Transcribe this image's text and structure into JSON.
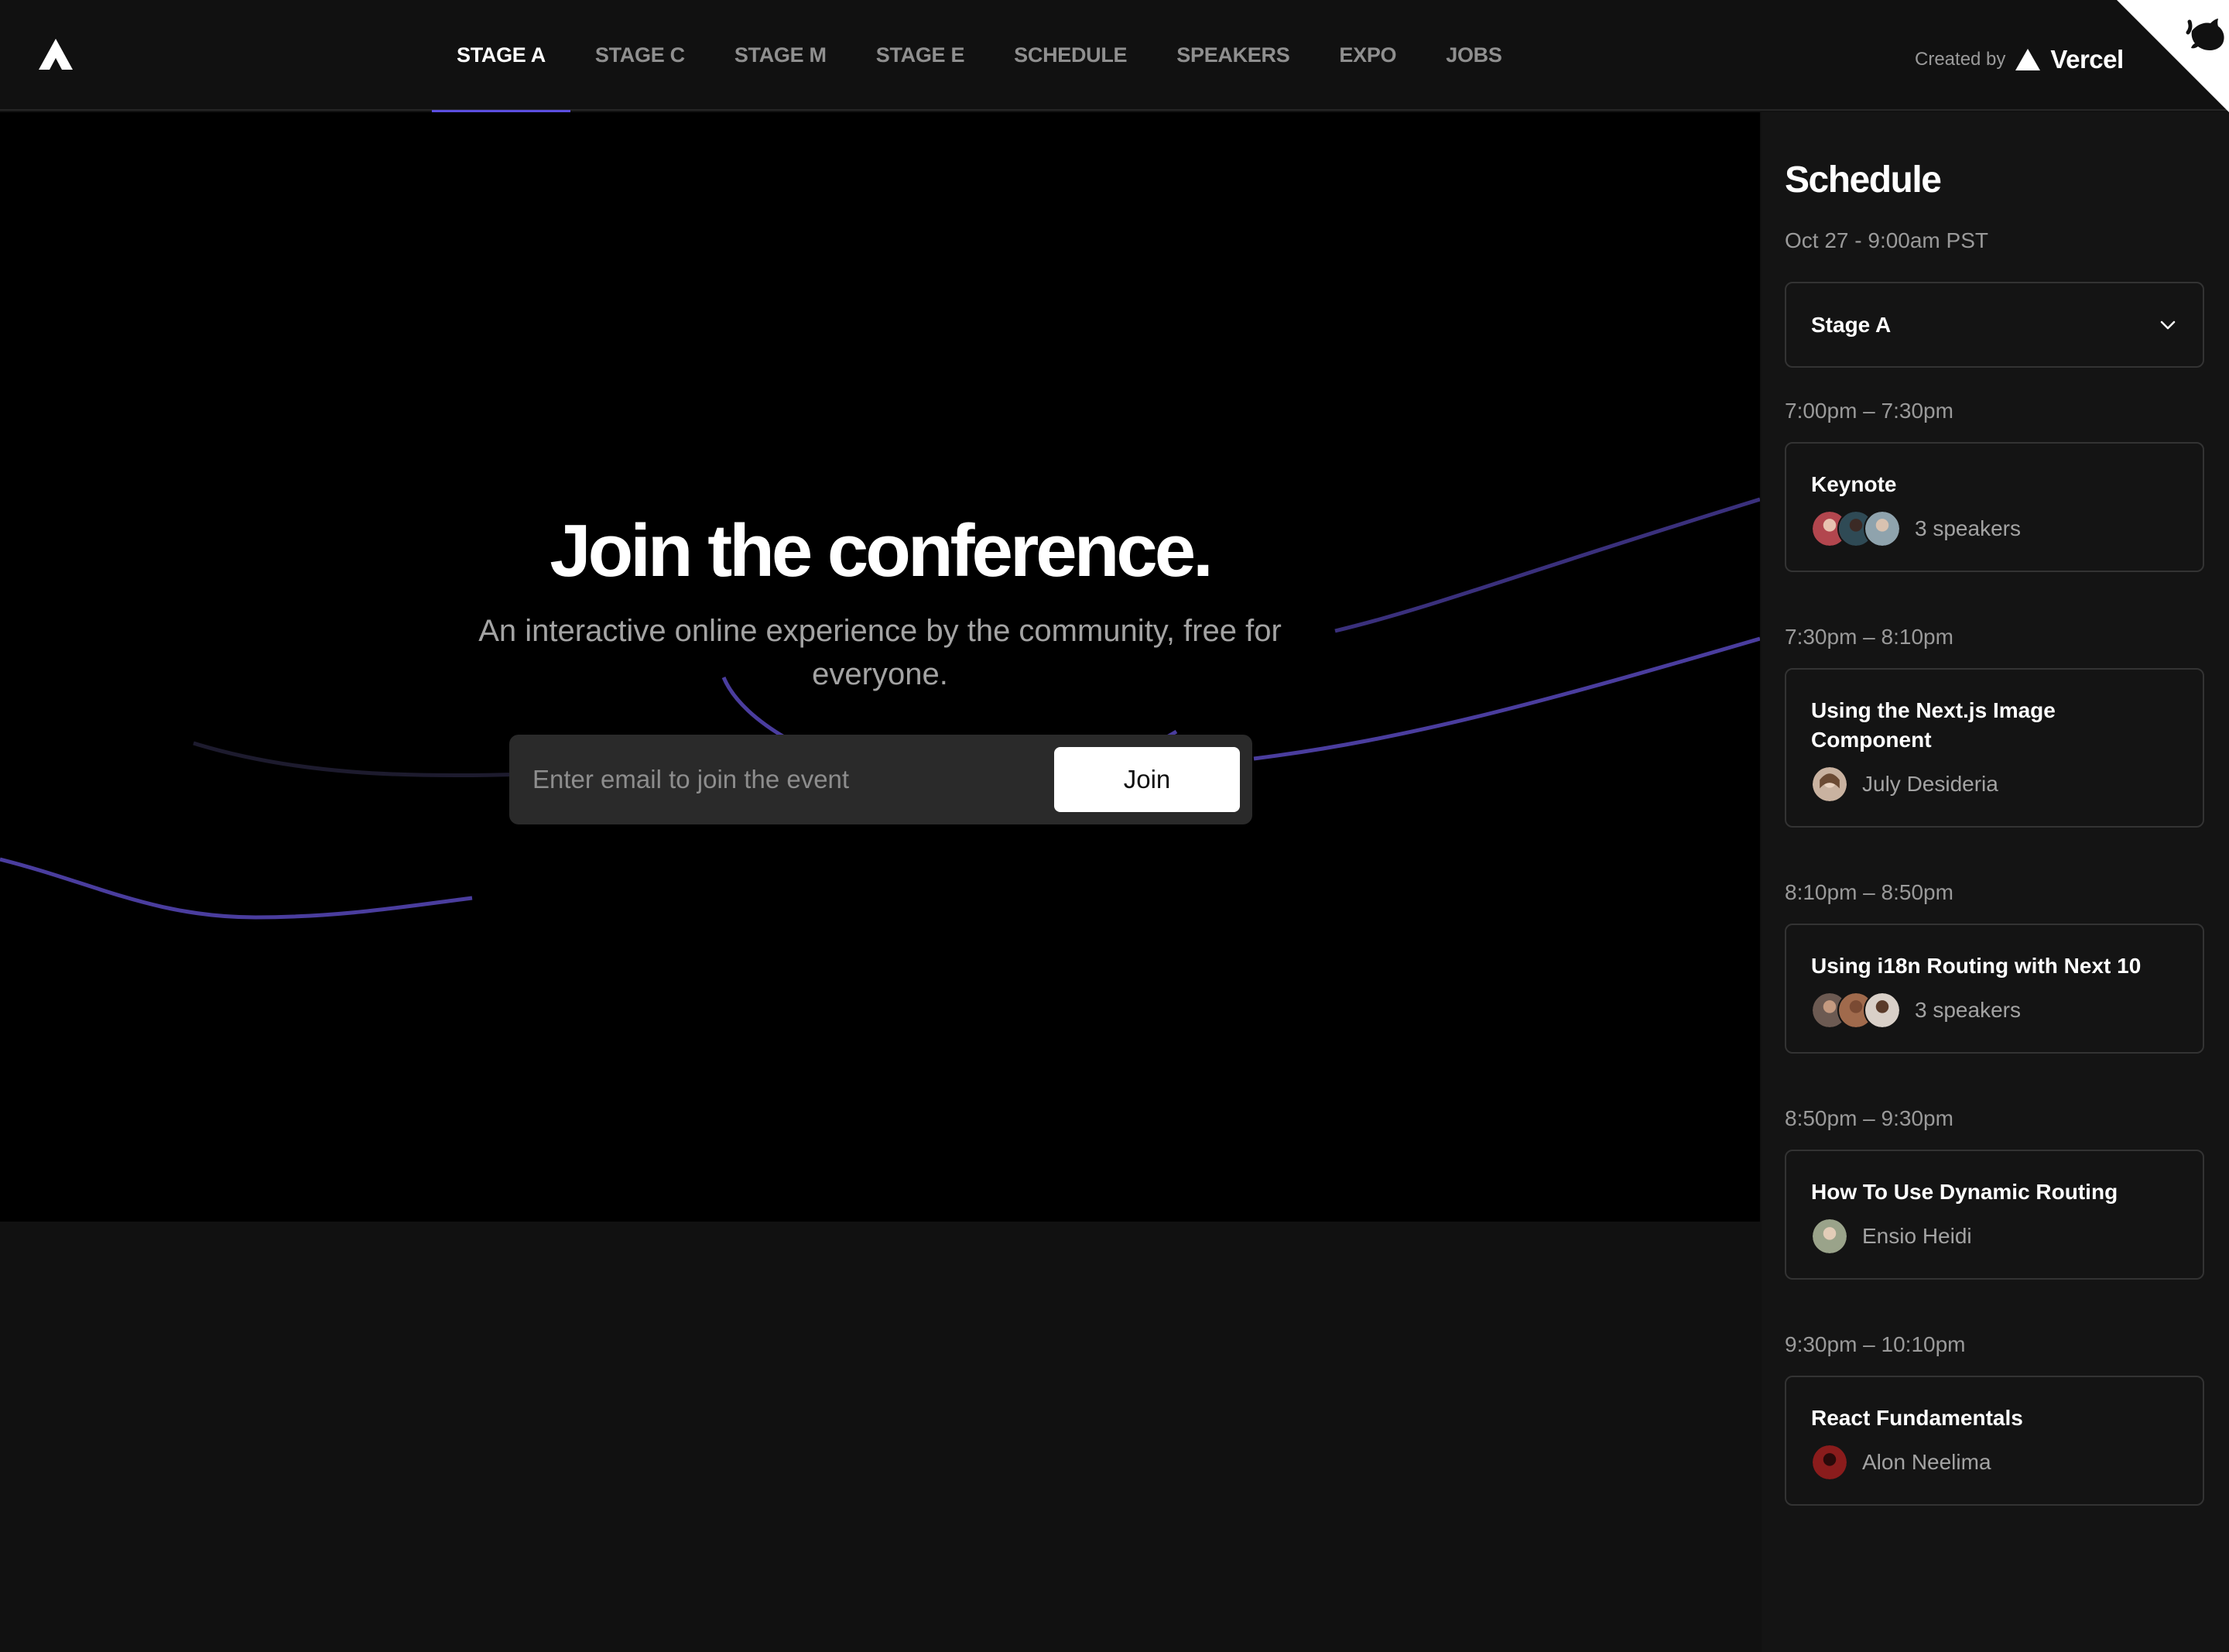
{
  "header": {
    "nav": [
      {
        "label": "Stage A",
        "active": true
      },
      {
        "label": "Stage C",
        "active": false
      },
      {
        "label": "Stage M",
        "active": false
      },
      {
        "label": "Stage E",
        "active": false
      },
      {
        "label": "Schedule",
        "active": false
      },
      {
        "label": "Speakers",
        "active": false
      },
      {
        "label": "Expo",
        "active": false
      },
      {
        "label": "Jobs",
        "active": false
      }
    ],
    "created_by": "Created by",
    "brand": "Vercel"
  },
  "hero": {
    "title": "Join the conference.",
    "subtitle": "An interactive online experience by the community, free for everyone.",
    "email_placeholder": "Enter email to join the event",
    "join_label": "Join"
  },
  "sidebar": {
    "title": "Schedule",
    "date": "Oct 27 - 9:00am PST",
    "stage_selected": "Stage A",
    "slots": [
      {
        "time": "7:00pm – 7:30pm",
        "title": "Keynote",
        "meta": "3 speakers",
        "avatars": [
          "#b2464e",
          "#2f4a55",
          "#8fa3ad"
        ]
      },
      {
        "time": "7:30pm – 8:10pm",
        "title": "Using the Next.js Image Component",
        "meta": "July Desideria",
        "avatars": [
          "#c9b2a0"
        ]
      },
      {
        "time": "8:10pm – 8:50pm",
        "title": "Using i18n Routing with Next 10",
        "meta": "3 speakers",
        "avatars": [
          "#6c5a52",
          "#a06a4c",
          "#d9d0c8"
        ]
      },
      {
        "time": "8:50pm – 9:30pm",
        "title": "How To Use Dynamic Routing",
        "meta": "Ensio Heidi",
        "avatars": [
          "#9aa38a"
        ]
      },
      {
        "time": "9:30pm – 10:10pm",
        "title": "React Fundamentals",
        "meta": "Alon Neelima",
        "avatars": [
          "#8a1c1c"
        ]
      }
    ]
  },
  "colors": {
    "accent": "#5b4ee0",
    "background": "#111111",
    "hero_background": "#000000",
    "wave": "#4a3d9e"
  }
}
